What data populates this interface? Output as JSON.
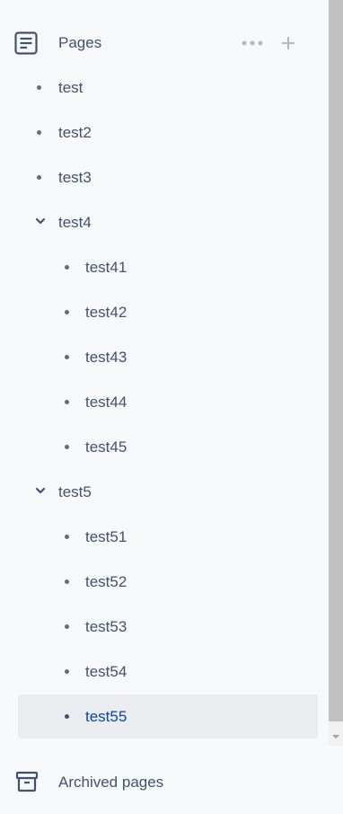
{
  "header": {
    "title": "Pages",
    "icon": "document-icon",
    "actions": [
      "more-icon",
      "plus-icon"
    ]
  },
  "tree": [
    {
      "label": "test",
      "level": 0,
      "type": "leaf"
    },
    {
      "label": "test2",
      "level": 0,
      "type": "leaf"
    },
    {
      "label": "test3",
      "level": 0,
      "type": "leaf"
    },
    {
      "label": "test4",
      "level": 0,
      "type": "expanded"
    },
    {
      "label": "test41",
      "level": 1,
      "type": "leaf"
    },
    {
      "label": "test42",
      "level": 1,
      "type": "leaf"
    },
    {
      "label": "test43",
      "level": 1,
      "type": "leaf"
    },
    {
      "label": "test44",
      "level": 1,
      "type": "leaf"
    },
    {
      "label": "test45",
      "level": 1,
      "type": "leaf"
    },
    {
      "label": "test5",
      "level": 0,
      "type": "expanded"
    },
    {
      "label": "test51",
      "level": 1,
      "type": "leaf"
    },
    {
      "label": "test52",
      "level": 1,
      "type": "leaf"
    },
    {
      "label": "test53",
      "level": 1,
      "type": "leaf"
    },
    {
      "label": "test54",
      "level": 1,
      "type": "leaf"
    },
    {
      "label": "test55",
      "level": 1,
      "type": "leaf",
      "selected": true
    }
  ],
  "footer": {
    "label": "Archived pages",
    "icon": "archive-icon"
  },
  "colors": {
    "background": "#f7f8fa",
    "text": "#42526e",
    "selected_text": "#0747a6",
    "selected_bg": "#ebecf0",
    "muted_icon": "#b3b9c4"
  }
}
